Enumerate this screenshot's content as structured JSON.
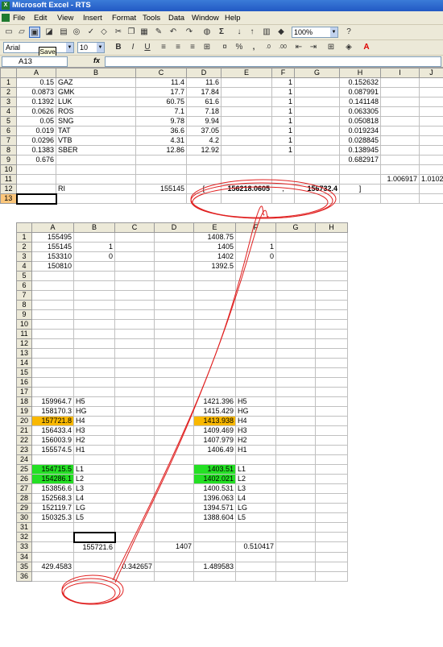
{
  "window": {
    "title": "Microsoft Excel - RTS"
  },
  "menu": [
    "File",
    "Edit",
    "View",
    "Insert",
    "Format",
    "Tools",
    "Data",
    "Window",
    "Help"
  ],
  "toolbar": {
    "zoom": "100%",
    "font": "Arial",
    "font_size": "10",
    "tooltip": "Save",
    "bold": "B",
    "italic": "I",
    "underline": "U",
    "percent": "%",
    "comma": ",",
    "sigma": "Σ"
  },
  "formula_bar": {
    "name_box": "A13",
    "fx": "fx",
    "formula": ""
  },
  "sheet1": {
    "columns": [
      "A",
      "B",
      "C",
      "D",
      "E",
      "F",
      "G",
      "H",
      "I",
      "J"
    ],
    "rows": [
      [
        "1",
        "0.15",
        "GAZ",
        "11.4",
        "11.6",
        "",
        "1",
        "",
        "0.152632",
        "",
        ""
      ],
      [
        "2",
        "0.0873",
        "GMK",
        "17.7",
        "17.84",
        "",
        "1",
        "",
        "0.087991",
        "",
        ""
      ],
      [
        "3",
        "0.1392",
        "LUK",
        "60.75",
        "61.6",
        "",
        "1",
        "",
        "0.141148",
        "",
        ""
      ],
      [
        "4",
        "0.0626",
        "ROS",
        "7.1",
        "7.18",
        "",
        "1",
        "",
        "0.063305",
        "",
        ""
      ],
      [
        "5",
        "0.05",
        "SNG",
        "9.78",
        "9.94",
        "",
        "1",
        "",
        "0.050818",
        "",
        ""
      ],
      [
        "6",
        "0.019",
        "TAT",
        "36.6",
        "37.05",
        "",
        "1",
        "",
        "0.019234",
        "",
        ""
      ],
      [
        "7",
        "0.0296",
        "VTB",
        "4.31",
        "4.2",
        "",
        "1",
        "",
        "0.028845",
        "",
        ""
      ],
      [
        "8",
        "0.1383",
        "SBER",
        "12.86",
        "12.92",
        "",
        "1",
        "",
        "0.138945",
        "",
        ""
      ],
      [
        "9",
        "0.676",
        "",
        "",
        "",
        "",
        "",
        "",
        "0.682917",
        "",
        ""
      ],
      [
        "10",
        "",
        "",
        "",
        "",
        "",
        "",
        "",
        "",
        "",
        ""
      ],
      [
        "11",
        "",
        "",
        "",
        "",
        "",
        "",
        "",
        "",
        "1.006917",
        "1.010232"
      ],
      [
        "12",
        "",
        "RI",
        "155145",
        "[",
        "156218.0605",
        ",",
        "156732.4",
        "]",
        "",
        ""
      ],
      [
        "13",
        "",
        "",
        "",
        "",
        "",
        "",
        "",
        "",
        "",
        ""
      ]
    ]
  },
  "sheet2": {
    "columns": [
      "A",
      "B",
      "C",
      "D",
      "E",
      "F",
      "G",
      "H"
    ],
    "rows": [
      [
        "1",
        "155495",
        "",
        "",
        "",
        "1408.75",
        "",
        "",
        ""
      ],
      [
        "2",
        "155145",
        "1",
        "",
        "",
        "1405",
        "1",
        "",
        ""
      ],
      [
        "3",
        "153310",
        "0",
        "",
        "",
        "1402",
        "0",
        "",
        ""
      ],
      [
        "4",
        "150810",
        "",
        "",
        "",
        "1392.5",
        "",
        "",
        ""
      ],
      [
        "5",
        "",
        "",
        "",
        "",
        "",
        "",
        "",
        ""
      ],
      [
        "6",
        "",
        "",
        "",
        "",
        "",
        "",
        "",
        ""
      ],
      [
        "7",
        "",
        "",
        "",
        "",
        "",
        "",
        "",
        ""
      ],
      [
        "8",
        "",
        "",
        "",
        "",
        "",
        "",
        "",
        ""
      ],
      [
        "9",
        "",
        "",
        "",
        "",
        "",
        "",
        "",
        ""
      ],
      [
        "10",
        "",
        "",
        "",
        "",
        "",
        "",
        "",
        ""
      ],
      [
        "11",
        "",
        "",
        "",
        "",
        "",
        "",
        "",
        ""
      ],
      [
        "12",
        "",
        "",
        "",
        "",
        "",
        "",
        "",
        ""
      ],
      [
        "13",
        "",
        "",
        "",
        "",
        "",
        "",
        "",
        ""
      ],
      [
        "14",
        "",
        "",
        "",
        "",
        "",
        "",
        "",
        ""
      ],
      [
        "15",
        "",
        "",
        "",
        "",
        "",
        "",
        "",
        ""
      ],
      [
        "16",
        "",
        "",
        "",
        "",
        "",
        "",
        "",
        ""
      ],
      [
        "17",
        "",
        "",
        "",
        "",
        "",
        "",
        "",
        ""
      ],
      [
        "18",
        "159964.7",
        "H5",
        "",
        "",
        "1421.396",
        "H5",
        "",
        ""
      ],
      [
        "19",
        "158170.3",
        "HG",
        "",
        "",
        "1415.429",
        "HG",
        "",
        ""
      ],
      [
        "20",
        "157721.8",
        "H4",
        "",
        "",
        "1413.938",
        "H4",
        "",
        ""
      ],
      [
        "21",
        "156433.4",
        "H3",
        "",
        "",
        "1409.469",
        "H3",
        "",
        ""
      ],
      [
        "22",
        "156003.9",
        "H2",
        "",
        "",
        "1407.979",
        "H2",
        "",
        ""
      ],
      [
        "23",
        "155574.5",
        "H1",
        "",
        "",
        "1406.49",
        "H1",
        "",
        ""
      ],
      [
        "24",
        "",
        "",
        "",
        "",
        "",
        "",
        "",
        ""
      ],
      [
        "25",
        "154715.5",
        "L1",
        "",
        "",
        "1403.51",
        "L1",
        "",
        ""
      ],
      [
        "26",
        "154286.1",
        "L2",
        "",
        "",
        "1402.021",
        "L2",
        "",
        ""
      ],
      [
        "27",
        "153856.6",
        "L3",
        "",
        "",
        "1400.531",
        "L3",
        "",
        ""
      ],
      [
        "28",
        "152568.3",
        "L4",
        "",
        "",
        "1396.063",
        "L4",
        "",
        ""
      ],
      [
        "29",
        "152119.7",
        "LG",
        "",
        "",
        "1394.571",
        "LG",
        "",
        ""
      ],
      [
        "30",
        "150325.3",
        "L5",
        "",
        "",
        "1388.604",
        "L5",
        "",
        ""
      ],
      [
        "31",
        "",
        "",
        "",
        "",
        "",
        "",
        "",
        ""
      ],
      [
        "32",
        "",
        "",
        "",
        "",
        "",
        "",
        "",
        ""
      ],
      [
        "33",
        "",
        "155721.6",
        "",
        "1407",
        "",
        "0.510417",
        "",
        ""
      ],
      [
        "34",
        "",
        "",
        "",
        "",
        "",
        "",
        "",
        ""
      ],
      [
        "35",
        "429.4583",
        "",
        "0.342657",
        "",
        "1.489583",
        "",
        "",
        ""
      ],
      [
        "36",
        "",
        "",
        "",
        "",
        "",
        "",
        "",
        ""
      ]
    ]
  },
  "colors": {
    "highlight_orange": "#f9b800",
    "highlight_green": "#24e024",
    "annotation": "#e02020"
  }
}
